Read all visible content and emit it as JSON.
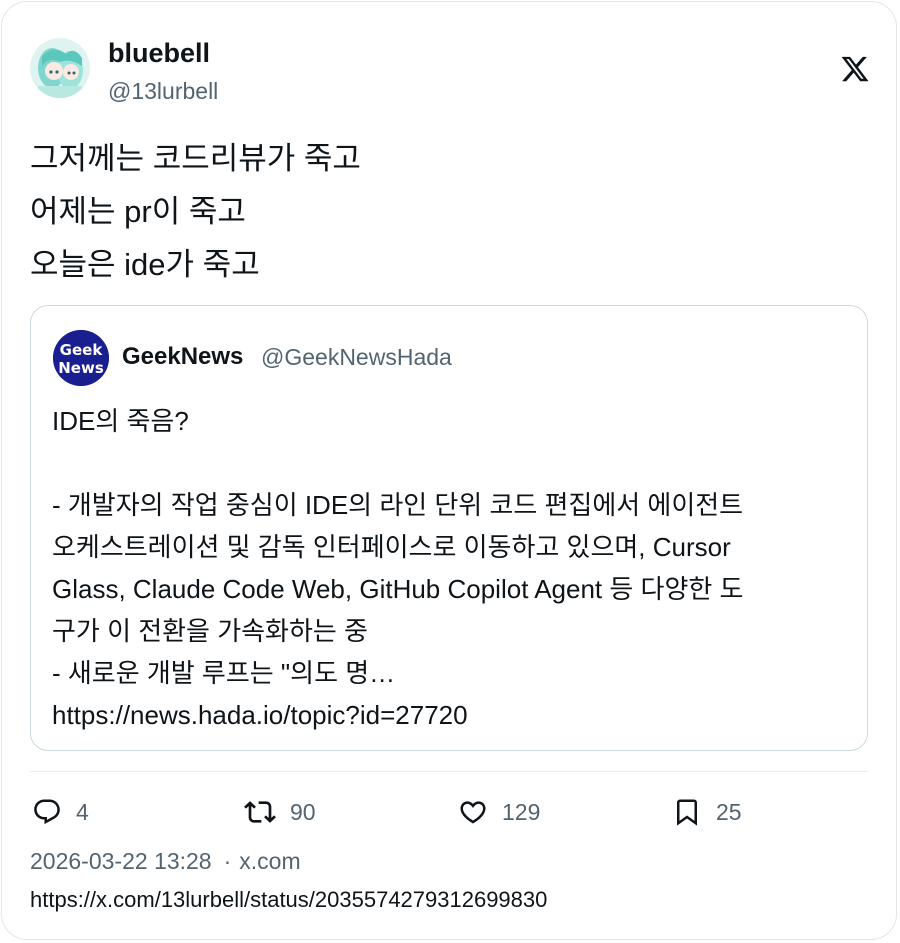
{
  "author": {
    "display_name": "bluebell",
    "handle": "@13lurbell",
    "avatar_icon": "anime-avatar"
  },
  "brand_icon": "x-logo-icon",
  "tweet": {
    "lines": [
      "그저께는 코드리뷰가 죽고",
      "어제는 pr이 죽고",
      "오늘은 ide가 죽고"
    ]
  },
  "quote": {
    "avatar_text_top": "Geek",
    "avatar_text_bottom": "News",
    "name": "GeekNews",
    "handle": "@GeekNewsHada",
    "lines": [
      "IDE의 죽음?",
      "",
      "- 개발자의 작업 중심이 IDE의 라인 단위 코드 편집에서 에이전트",
      "오케스트레이션 및 감독 인터페이스로 이동하고 있으며, Cursor",
      "Glass, Claude Code Web, GitHub Copilot Agent 등 다양한 도",
      "구가 이 전환을 가속화하는 중",
      "- 새로운 개발 루프는 \"의도 명…",
      "https://news.hada.io/topic?id=27720"
    ]
  },
  "actions": {
    "replies": "4",
    "reposts": "90",
    "likes": "129",
    "bookmarks": "25"
  },
  "meta": {
    "timestamp": "2026-03-22 13:28",
    "separator": "·",
    "source": "x.com"
  },
  "status_url": "https://x.com/13lurbell/status/2035574279312699830",
  "colors": {
    "text": "#0f1419",
    "secondary": "#536471",
    "border": "#cfd9de",
    "geeknews_bg": "#1a1f8f"
  }
}
